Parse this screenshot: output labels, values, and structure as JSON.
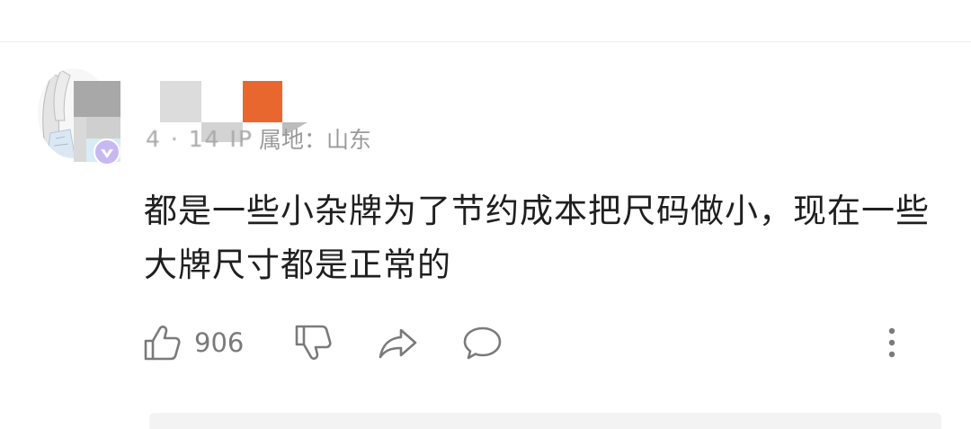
{
  "comment": {
    "meta_location": "属地：山东",
    "meta_obscured": "4 · 14 IP",
    "text": "都是一些小杂牌为了节约成本把尺码做小，现在一些大牌尺寸都是正常的"
  },
  "actions": {
    "like_icon": "thumbs-up-icon",
    "like_count": "906",
    "dislike_icon": "thumbs-down-icon",
    "share_icon": "share-arrow-icon",
    "reply_icon": "speech-bubble-icon",
    "more_icon": "more-vertical-icon"
  },
  "colors": {
    "text": "#1f1f1f",
    "meta": "#9a9a9a",
    "icon": "#7a7a7a",
    "mosaic_orange": "#e8672f"
  }
}
